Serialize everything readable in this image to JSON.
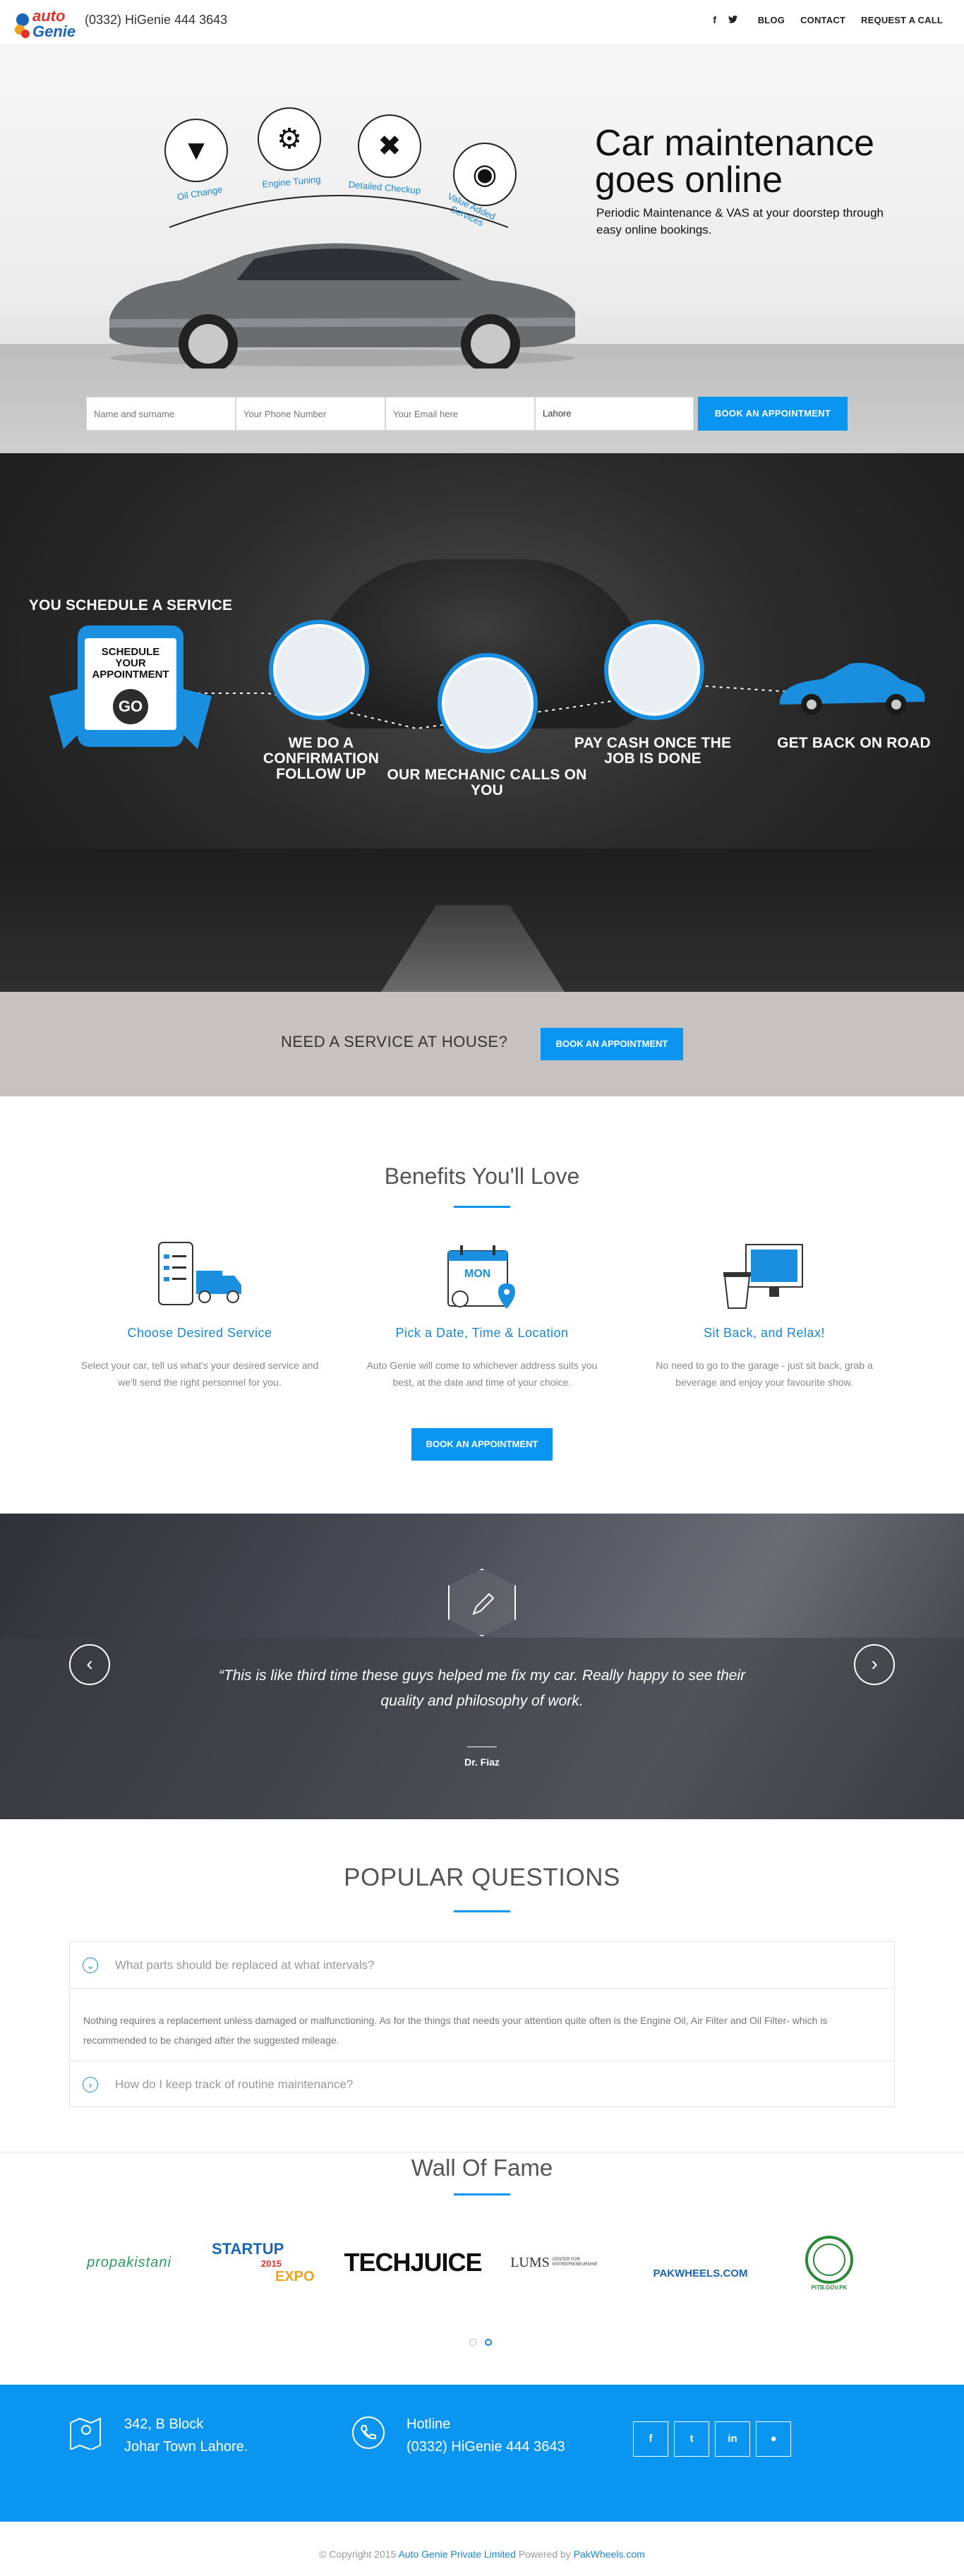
{
  "header": {
    "logo_top": "auto",
    "logo_bottom": "Genie",
    "phone": "(0332) HiGenie 444 3643",
    "social": [
      "f",
      "ᴛ"
    ],
    "nav": [
      "BLOG",
      "CONTACT",
      "REQUEST A CALL"
    ]
  },
  "hero": {
    "title": "Car maintenance goes online",
    "subtitle": "Periodic Maintenance & VAS at your doorstep through easy online bookings.",
    "services": [
      "Oil Change",
      "Engine Tuning",
      "Detailed Checkup",
      "Value Added Services"
    ]
  },
  "form": {
    "name_placeholder": "Name and surname",
    "phone_placeholder": "Your Phone Number",
    "email_placeholder": "Your Email here",
    "city": "Lahore",
    "button": "BOOK AN APPOINTMENT"
  },
  "steps": {
    "step1": "YOU SCHEDULE A SERVICE",
    "phone_screen": "SCHEDULE YOUR APPOINTMENT",
    "go": "GO",
    "step2": "WE DO A CONFIRMATION FOLLOW UP",
    "step3": "OUR MECHANIC CALLS ON YOU",
    "step4": "PAY CASH ONCE THE JOB IS DONE",
    "step5": "GET BACK ON ROAD"
  },
  "cta": {
    "text": "NEED A SERVICE AT HOUSE?",
    "button": "BOOK AN APPOINTMENT"
  },
  "benefits": {
    "title": "Benefits You'll Love",
    "items": [
      {
        "title": "Choose Desired Service",
        "text": "Select your car, tell us what's your desired service and we'll send the right personnel for you."
      },
      {
        "title": "Pick a Date, Time & Location",
        "text": "Auto Genie will come to whichever address suits you best, at the date and time of your choice.",
        "calendar": "MON"
      },
      {
        "title": "Sit Back, and Relax!",
        "text": "No need to go to the garage - just sit back, grab a beverage and enjoy your favourite show."
      }
    ],
    "button": "BOOK AN APPOINTMENT"
  },
  "testimonial": {
    "quote": "“This is like third time these guys helped me fix my car. Really happy to see their quality and philosophy of work.",
    "author": "Dr. Fiaz"
  },
  "faq": {
    "title": "POPULAR QUESTIONS",
    "q1": "What parts should be replaced at what intervals?",
    "a1": "Nothing requires a replacement unless damaged or malfunctioning. As for the things that needs your attention quite often is the Engine Oil, Air Filter and Oil Filter- which is recommended to be changed after the suggested mileage.",
    "q2": "How do I keep track of routine maintenance?"
  },
  "wall": {
    "title": "Wall Of Fame",
    "logos": [
      "propakistani",
      "STARTUP",
      "2015",
      "EXPO",
      "TECHJUICE",
      "LUMS",
      "CENTER FOR ENTREPRENEURSHIP",
      "PAKWHEELS.COM",
      "PITB.GOV.PK"
    ]
  },
  "footer": {
    "address1": "342, B Block",
    "address2": "Johar Town Lahore.",
    "hotline_label": "Hotline",
    "hotline": "(0332) HiGenie 444 3643",
    "social": [
      "f",
      "t",
      "in",
      "●"
    ],
    "copyright": "© Copyright 2015",
    "company": "Auto Genie Private Limited",
    "powered": "Powered by",
    "pakwheels": "PakWheels.com"
  },
  "colors": {
    "accent": "#0a96f0",
    "accent_text": "#1a86d6",
    "dark_band": "#1e1e1e",
    "cta_band": "#c7c2c2"
  }
}
